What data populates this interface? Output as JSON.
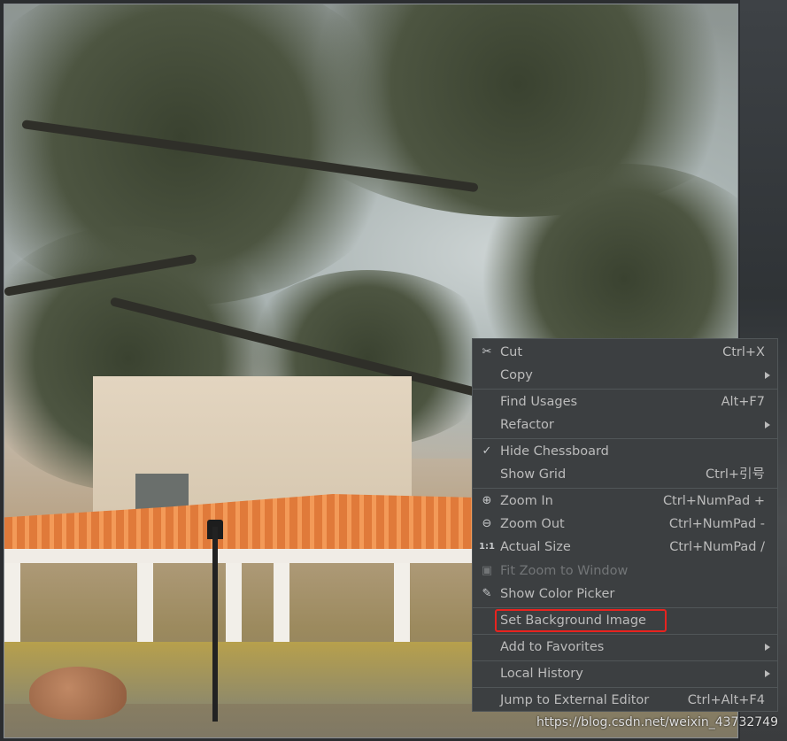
{
  "menu": {
    "items": [
      {
        "label": "Cut",
        "shortcut": "Ctrl+X",
        "icon": "scissors-icon",
        "glyph": "✂"
      },
      {
        "label": "Copy",
        "shortcut": "",
        "submenu": true
      },
      {
        "label": "Find Usages",
        "shortcut": "Alt+F7"
      },
      {
        "label": "Refactor",
        "shortcut": "",
        "submenu": true
      },
      {
        "label": "Hide Chessboard",
        "shortcut": "",
        "icon": "check-icon",
        "glyph": "✓"
      },
      {
        "label": "Show Grid",
        "shortcut": "Ctrl+引号"
      },
      {
        "label": "Zoom In",
        "shortcut": "Ctrl+NumPad +",
        "icon": "zoom-in-icon",
        "glyph": "⊕"
      },
      {
        "label": "Zoom Out",
        "shortcut": "Ctrl+NumPad -",
        "icon": "zoom-out-icon",
        "glyph": "⊖"
      },
      {
        "label": "Actual Size",
        "shortcut": "Ctrl+NumPad /",
        "icon": "actual-size-icon",
        "glyph": "1:1"
      },
      {
        "label": "Fit Zoom to Window",
        "shortcut": "",
        "icon": "fit-zoom-icon",
        "glyph": "▣",
        "disabled": true
      },
      {
        "label": "Show Color Picker",
        "shortcut": "",
        "icon": "eyedropper-icon",
        "glyph": "✎"
      },
      {
        "label": "Set Background Image",
        "shortcut": ""
      },
      {
        "label": "Add to Favorites",
        "shortcut": "",
        "submenu": true
      },
      {
        "label": "Local History",
        "shortcut": "",
        "submenu": true
      },
      {
        "label": "Jump to External Editor",
        "shortcut": "Ctrl+Alt+F4"
      }
    ]
  },
  "watermark": "https://blog.csdn.net/weixin_43732749",
  "colors": {
    "menu_bg": "#3c3f41",
    "menu_text": "#bbbbbb",
    "highlight_border": "#e8231f"
  }
}
